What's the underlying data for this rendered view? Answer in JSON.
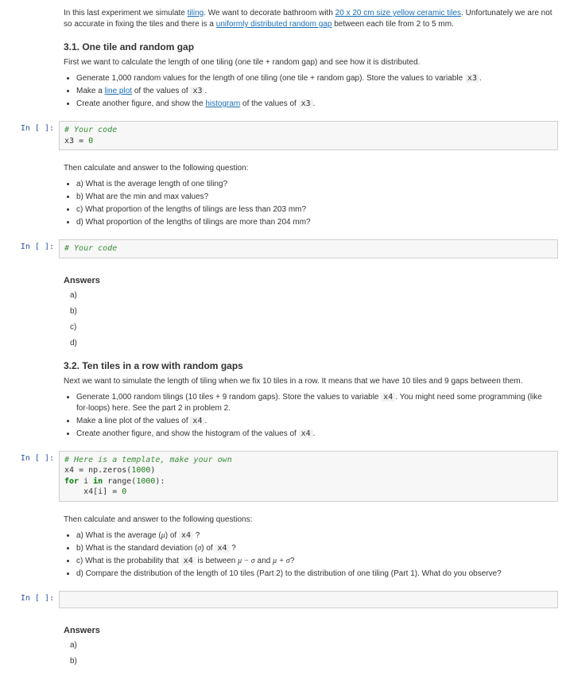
{
  "intro": {
    "pre": "In this last experiment we simulate ",
    "link1": "tiling",
    "mid1": ". We want to decorate bathroom with ",
    "link2": "20 x 20 cm size yellow ceramic tiles",
    "mid2": ". Unfortunately we are not so accurate in fixing the tiles and there is a ",
    "link3": "uniformly distributed random gap",
    "post": " between each tile from 2 to 5 mm."
  },
  "sec31": {
    "title": "3.1. One tile and random gap",
    "p1": "First we want to calculate the length of one tiling (one tile + random gap) and see how it is distributed.",
    "b1_pre": "Generate 1,000 random values for the length of one tiling (one tile + random gap). Store the values to variable ",
    "b1_code": "x3",
    "b1_post": ".",
    "b2_pre": "Make a ",
    "b2_link": "line plot",
    "b2_mid": " of the values of ",
    "b2_code": "x3",
    "b2_post": ".",
    "b3_pre": "Create another figure, and show the ",
    "b3_link": "histogram",
    "b3_mid": " of the values of ",
    "b3_code": "x3",
    "b3_post": "."
  },
  "prompt": "In [ ]:",
  "code1": {
    "comment": "# Your code",
    "line2a": "x3 ",
    "line2b": "=",
    "line2c": " ",
    "line2d": "0"
  },
  "q1": {
    "lead": "Then calculate and answer to the following question:",
    "a": "a) What is the average length of one tiling?",
    "b": "b) What are the min and max values?",
    "c": "c) What proportion of the lengths of tilings are less than 203 mm?",
    "d": "d) What proportion of the lengths of tilings are more than 204 mm?"
  },
  "code2": {
    "comment": "# Your code"
  },
  "answers_title": "Answers",
  "ans_labels": {
    "a": "a)",
    "b": "b)",
    "c": "c)",
    "d": "d)"
  },
  "sec32": {
    "title": "3.2. Ten tiles in a row with random gaps",
    "p1": "Next we want to simulate the length of tiling when we fix 10 tiles in a row. It means that we have 10 tiles and 9 gaps between them.",
    "b1_pre": "Generate 1,000 random tilings (10 tiles + 9 random gaps). Store the values to variable ",
    "b1_code": "x4",
    "b1_post": ". You might need some programming (like for-loops) here. See the part 2 in problem 2.",
    "b2_pre": "Make a line plot of the values of ",
    "b2_code": "x4",
    "b2_post": ".",
    "b3_pre": "Create another figure, and show the histogram of the values of ",
    "b3_code": "x4",
    "b3_post": "."
  },
  "code3": {
    "comment": "# Here is a template, make your own",
    "l2a": "x4 ",
    "l2b": "=",
    "l2c": " np.zeros(",
    "l2d": "1000",
    "l2e": ")",
    "l3a": "for",
    "l3b": " i ",
    "l3c": "in",
    "l3d": " range(",
    "l3e": "1000",
    "l3f": "):",
    "l4a": "    x4[i] ",
    "l4b": "=",
    "l4c": " ",
    "l4d": "0"
  },
  "q2": {
    "lead": "Then calculate and answer to the following questions:",
    "a_pre": "a) What is the average (",
    "a_mu": "μ",
    "a_mid": ") of ",
    "a_code": "x4",
    "a_post": " ?",
    "b_pre": "b) What is the standard deviation (",
    "b_sig": "σ",
    "b_mid": ") of ",
    "b_code": "x4",
    "b_post": " ?",
    "c_pre": "c) What is the probability that ",
    "c_code": "x4",
    "c_mid": " is between ",
    "c_expr1": "μ − σ",
    "c_and": " and ",
    "c_expr2": "μ + σ",
    "c_post": "?",
    "d": "d) Compare the distribution of the length of 10 tiles (Part 2) to the distribution of one tiling (Part 1). What do you observe?"
  }
}
